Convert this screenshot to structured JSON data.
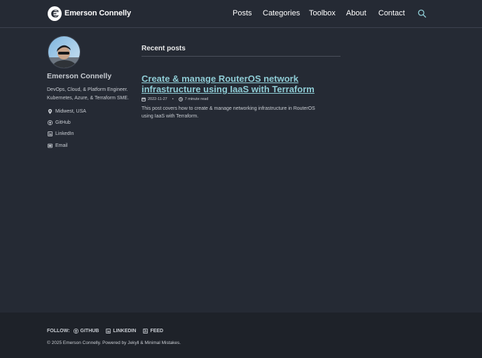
{
  "masthead": {
    "site_title": "Emerson Connelly",
    "nav": [
      "Posts",
      "Categories",
      "Toolbox",
      "About",
      "Contact"
    ],
    "search_icon": "search-icon"
  },
  "author": {
    "name": "Emerson Connelly",
    "bio_line1": "DevOps, Cloud, & Platform Engineer.",
    "bio_line2": "Kubernetes, Azure, & Terraform SME.",
    "links": [
      {
        "label": "Midwest, USA",
        "icon": "map-marker-icon"
      },
      {
        "label": "GitHub",
        "icon": "github-icon"
      },
      {
        "label": "LinkedIn",
        "icon": "linkedin-icon"
      },
      {
        "label": "Email",
        "icon": "email-icon"
      }
    ]
  },
  "main": {
    "section_title": "Recent posts",
    "post": {
      "title_line1": "Create & manage RouterOS network",
      "title_line2": "infrastructure using IaaS with Terraform",
      "date": "2022-11-27",
      "separator": "•",
      "read_time": "7 minute read",
      "excerpt_line1": "This post covers how to create & manage networking infrastructure in RouterOS",
      "excerpt_line2": "using IaaS with Terraform."
    }
  },
  "footer": {
    "follow_label": "FOLLOW:",
    "follow_links": [
      {
        "label": "GITHUB",
        "icon": "github-icon"
      },
      {
        "label": "LINKEDIN",
        "icon": "linkedin-icon"
      },
      {
        "label": "FEED",
        "icon": "rss-icon"
      }
    ],
    "copyright": "© 2025 Emerson Connelly. Powered by Jekyll & Minimal Mistakes."
  },
  "colors": {
    "background": "#252a34",
    "footer_background": "#1e2229",
    "link_accent": "#8ecbd4",
    "text": "#c8ccd2"
  }
}
